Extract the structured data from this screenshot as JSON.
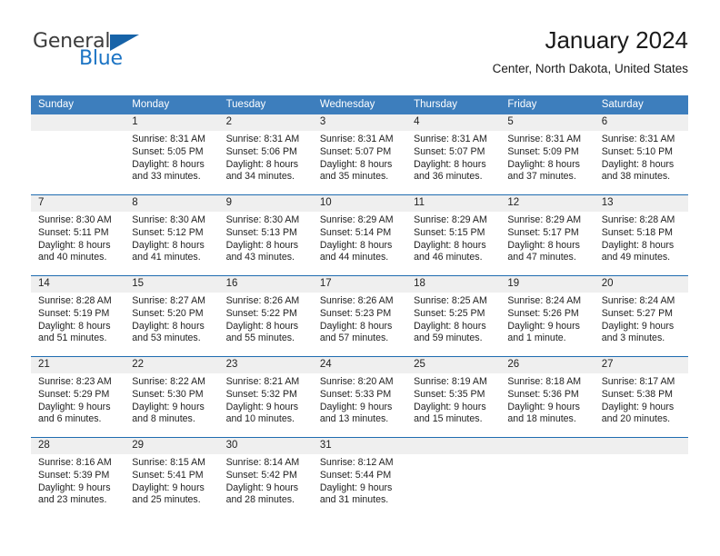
{
  "brand": {
    "name_part1": "General",
    "name_part2": "Blue",
    "triangle_color": "#1763a8",
    "blue_color": "#1c74c4"
  },
  "header": {
    "title": "January 2024",
    "subtitle": "Center, North Dakota, United States"
  },
  "colors": {
    "header_blue": "#3d7ebd",
    "separator_blue": "#1f6cb0",
    "daynum_band": "#efefef"
  },
  "weekday_headers": [
    "Sunday",
    "Monday",
    "Tuesday",
    "Wednesday",
    "Thursday",
    "Friday",
    "Saturday"
  ],
  "weeks": [
    [
      {
        "day": "",
        "sunrise": "",
        "sunset": "",
        "daylight1": "",
        "daylight2": "",
        "empty": true
      },
      {
        "day": "1",
        "sunrise": "Sunrise: 8:31 AM",
        "sunset": "Sunset: 5:05 PM",
        "daylight1": "Daylight: 8 hours",
        "daylight2": "and 33 minutes."
      },
      {
        "day": "2",
        "sunrise": "Sunrise: 8:31 AM",
        "sunset": "Sunset: 5:06 PM",
        "daylight1": "Daylight: 8 hours",
        "daylight2": "and 34 minutes."
      },
      {
        "day": "3",
        "sunrise": "Sunrise: 8:31 AM",
        "sunset": "Sunset: 5:07 PM",
        "daylight1": "Daylight: 8 hours",
        "daylight2": "and 35 minutes."
      },
      {
        "day": "4",
        "sunrise": "Sunrise: 8:31 AM",
        "sunset": "Sunset: 5:07 PM",
        "daylight1": "Daylight: 8 hours",
        "daylight2": "and 36 minutes."
      },
      {
        "day": "5",
        "sunrise": "Sunrise: 8:31 AM",
        "sunset": "Sunset: 5:09 PM",
        "daylight1": "Daylight: 8 hours",
        "daylight2": "and 37 minutes."
      },
      {
        "day": "6",
        "sunrise": "Sunrise: 8:31 AM",
        "sunset": "Sunset: 5:10 PM",
        "daylight1": "Daylight: 8 hours",
        "daylight2": "and 38 minutes."
      }
    ],
    [
      {
        "day": "7",
        "sunrise": "Sunrise: 8:30 AM",
        "sunset": "Sunset: 5:11 PM",
        "daylight1": "Daylight: 8 hours",
        "daylight2": "and 40 minutes."
      },
      {
        "day": "8",
        "sunrise": "Sunrise: 8:30 AM",
        "sunset": "Sunset: 5:12 PM",
        "daylight1": "Daylight: 8 hours",
        "daylight2": "and 41 minutes."
      },
      {
        "day": "9",
        "sunrise": "Sunrise: 8:30 AM",
        "sunset": "Sunset: 5:13 PM",
        "daylight1": "Daylight: 8 hours",
        "daylight2": "and 43 minutes."
      },
      {
        "day": "10",
        "sunrise": "Sunrise: 8:29 AM",
        "sunset": "Sunset: 5:14 PM",
        "daylight1": "Daylight: 8 hours",
        "daylight2": "and 44 minutes."
      },
      {
        "day": "11",
        "sunrise": "Sunrise: 8:29 AM",
        "sunset": "Sunset: 5:15 PM",
        "daylight1": "Daylight: 8 hours",
        "daylight2": "and 46 minutes."
      },
      {
        "day": "12",
        "sunrise": "Sunrise: 8:29 AM",
        "sunset": "Sunset: 5:17 PM",
        "daylight1": "Daylight: 8 hours",
        "daylight2": "and 47 minutes."
      },
      {
        "day": "13",
        "sunrise": "Sunrise: 8:28 AM",
        "sunset": "Sunset: 5:18 PM",
        "daylight1": "Daylight: 8 hours",
        "daylight2": "and 49 minutes."
      }
    ],
    [
      {
        "day": "14",
        "sunrise": "Sunrise: 8:28 AM",
        "sunset": "Sunset: 5:19 PM",
        "daylight1": "Daylight: 8 hours",
        "daylight2": "and 51 minutes."
      },
      {
        "day": "15",
        "sunrise": "Sunrise: 8:27 AM",
        "sunset": "Sunset: 5:20 PM",
        "daylight1": "Daylight: 8 hours",
        "daylight2": "and 53 minutes."
      },
      {
        "day": "16",
        "sunrise": "Sunrise: 8:26 AM",
        "sunset": "Sunset: 5:22 PM",
        "daylight1": "Daylight: 8 hours",
        "daylight2": "and 55 minutes."
      },
      {
        "day": "17",
        "sunrise": "Sunrise: 8:26 AM",
        "sunset": "Sunset: 5:23 PM",
        "daylight1": "Daylight: 8 hours",
        "daylight2": "and 57 minutes."
      },
      {
        "day": "18",
        "sunrise": "Sunrise: 8:25 AM",
        "sunset": "Sunset: 5:25 PM",
        "daylight1": "Daylight: 8 hours",
        "daylight2": "and 59 minutes."
      },
      {
        "day": "19",
        "sunrise": "Sunrise: 8:24 AM",
        "sunset": "Sunset: 5:26 PM",
        "daylight1": "Daylight: 9 hours",
        "daylight2": "and 1 minute."
      },
      {
        "day": "20",
        "sunrise": "Sunrise: 8:24 AM",
        "sunset": "Sunset: 5:27 PM",
        "daylight1": "Daylight: 9 hours",
        "daylight2": "and 3 minutes."
      }
    ],
    [
      {
        "day": "21",
        "sunrise": "Sunrise: 8:23 AM",
        "sunset": "Sunset: 5:29 PM",
        "daylight1": "Daylight: 9 hours",
        "daylight2": "and 6 minutes."
      },
      {
        "day": "22",
        "sunrise": "Sunrise: 8:22 AM",
        "sunset": "Sunset: 5:30 PM",
        "daylight1": "Daylight: 9 hours",
        "daylight2": "and 8 minutes."
      },
      {
        "day": "23",
        "sunrise": "Sunrise: 8:21 AM",
        "sunset": "Sunset: 5:32 PM",
        "daylight1": "Daylight: 9 hours",
        "daylight2": "and 10 minutes."
      },
      {
        "day": "24",
        "sunrise": "Sunrise: 8:20 AM",
        "sunset": "Sunset: 5:33 PM",
        "daylight1": "Daylight: 9 hours",
        "daylight2": "and 13 minutes."
      },
      {
        "day": "25",
        "sunrise": "Sunrise: 8:19 AM",
        "sunset": "Sunset: 5:35 PM",
        "daylight1": "Daylight: 9 hours",
        "daylight2": "and 15 minutes."
      },
      {
        "day": "26",
        "sunrise": "Sunrise: 8:18 AM",
        "sunset": "Sunset: 5:36 PM",
        "daylight1": "Daylight: 9 hours",
        "daylight2": "and 18 minutes."
      },
      {
        "day": "27",
        "sunrise": "Sunrise: 8:17 AM",
        "sunset": "Sunset: 5:38 PM",
        "daylight1": "Daylight: 9 hours",
        "daylight2": "and 20 minutes."
      }
    ],
    [
      {
        "day": "28",
        "sunrise": "Sunrise: 8:16 AM",
        "sunset": "Sunset: 5:39 PM",
        "daylight1": "Daylight: 9 hours",
        "daylight2": "and 23 minutes."
      },
      {
        "day": "29",
        "sunrise": "Sunrise: 8:15 AM",
        "sunset": "Sunset: 5:41 PM",
        "daylight1": "Daylight: 9 hours",
        "daylight2": "and 25 minutes."
      },
      {
        "day": "30",
        "sunrise": "Sunrise: 8:14 AM",
        "sunset": "Sunset: 5:42 PM",
        "daylight1": "Daylight: 9 hours",
        "daylight2": "and 28 minutes."
      },
      {
        "day": "31",
        "sunrise": "Sunrise: 8:12 AM",
        "sunset": "Sunset: 5:44 PM",
        "daylight1": "Daylight: 9 hours",
        "daylight2": "and 31 minutes."
      },
      {
        "day": "",
        "sunrise": "",
        "sunset": "",
        "daylight1": "",
        "daylight2": "",
        "empty": true
      },
      {
        "day": "",
        "sunrise": "",
        "sunset": "",
        "daylight1": "",
        "daylight2": "",
        "empty": true
      },
      {
        "day": "",
        "sunrise": "",
        "sunset": "",
        "daylight1": "",
        "daylight2": "",
        "empty": true
      }
    ]
  ]
}
